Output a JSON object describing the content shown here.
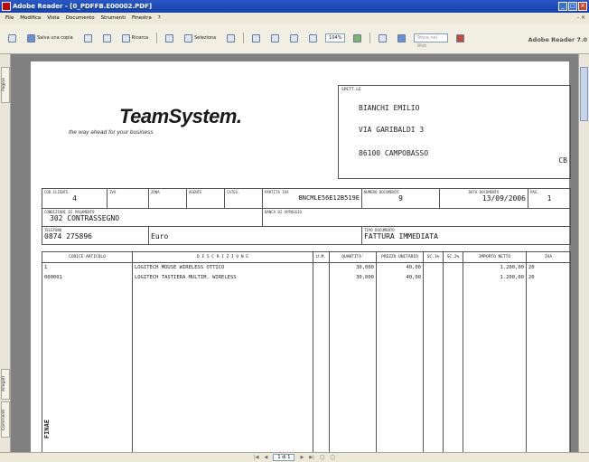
{
  "window": {
    "title": "Adobe Reader - [0_PDFFB.E00002.PDF]"
  },
  "menu": [
    "File",
    "Modifica",
    "Vista",
    "Documento",
    "Strumenti",
    "Finestra",
    "?"
  ],
  "toolbar": {
    "save_label": "Salva una copia",
    "search_label": "Ricerca",
    "select_label": "Seleziona",
    "zoom": "104%",
    "find_placeholder": "Trova nel Web",
    "brand_adobe": "Adobe",
    "brand_reader": "Reader 7.0"
  },
  "sidebar": {
    "tab_pages": "Pagine",
    "tab_attach": "Allegati",
    "tab_comments": "Commenti"
  },
  "status": {
    "page": "1 di 1"
  },
  "invoice": {
    "logo": "TeamSystem.",
    "tagline": "the way ahead for your business",
    "addr_label": "SPETT.LE",
    "addr_name": "BIANCHI EMILIO",
    "addr_street": "VIA GARIBALDI 3",
    "addr_city": "86100 CAMPOBASSO",
    "addr_prov": "CB",
    "h": {
      "cod_cliente": "COD.CLIENTE",
      "cod_cliente_val": "4",
      "iva": "IVA",
      "zona": "ZONA",
      "agente": "AGENTE",
      "categ": "CATEG.",
      "piva": "PARTITA IVA",
      "piva_val": "BNCMLE56E12B519E",
      "num_doc": "NUMERO DOCUMENTO",
      "num_doc_val": "9",
      "data_doc": "DATA DOCUMENTO",
      "data_doc_val": "13/09/2006",
      "pag": "PAG.",
      "pag_val": "1",
      "cond_pag": "CONDIZIONI DI PAGAMENTO",
      "cond_pag_val": "302 CONTRASSEGNO",
      "banca": "BANCA DI APPOGGIO",
      "telefono": "TELEFONO",
      "telefono_val": "0874 275896",
      "valuta_val": "Euro",
      "tipo_doc": "TIPO DOCUMENTO",
      "tipo_doc_val": "FATTURA IMMEDIATA"
    },
    "cols": [
      "CODICE ARTICOLO",
      "D E S C R I Z I O N E",
      "U.M.",
      "QUANTITA'",
      "PREZZO UNITARIO",
      "SC.1%",
      "SC.2%",
      "IMPORTO NETTO",
      "IVA"
    ],
    "rows": [
      {
        "code": "1",
        "desc": "LOGITECH MOUSE WIRELESS OTTICO",
        "um": "",
        "qty": "30,000",
        "price": "40,00",
        "sc1": "",
        "sc2": "",
        "net": "1.200,00",
        "iva": "20"
      },
      {
        "code": "000001",
        "desc": "LOGITECH TASTIERA MULTIM. WIRELESS",
        "um": "",
        "qty": "30,000",
        "price": "40,00",
        "sc1": "",
        "sc2": "",
        "net": "1.200,00",
        "iva": "20"
      }
    ],
    "watermark": "FINAE"
  }
}
